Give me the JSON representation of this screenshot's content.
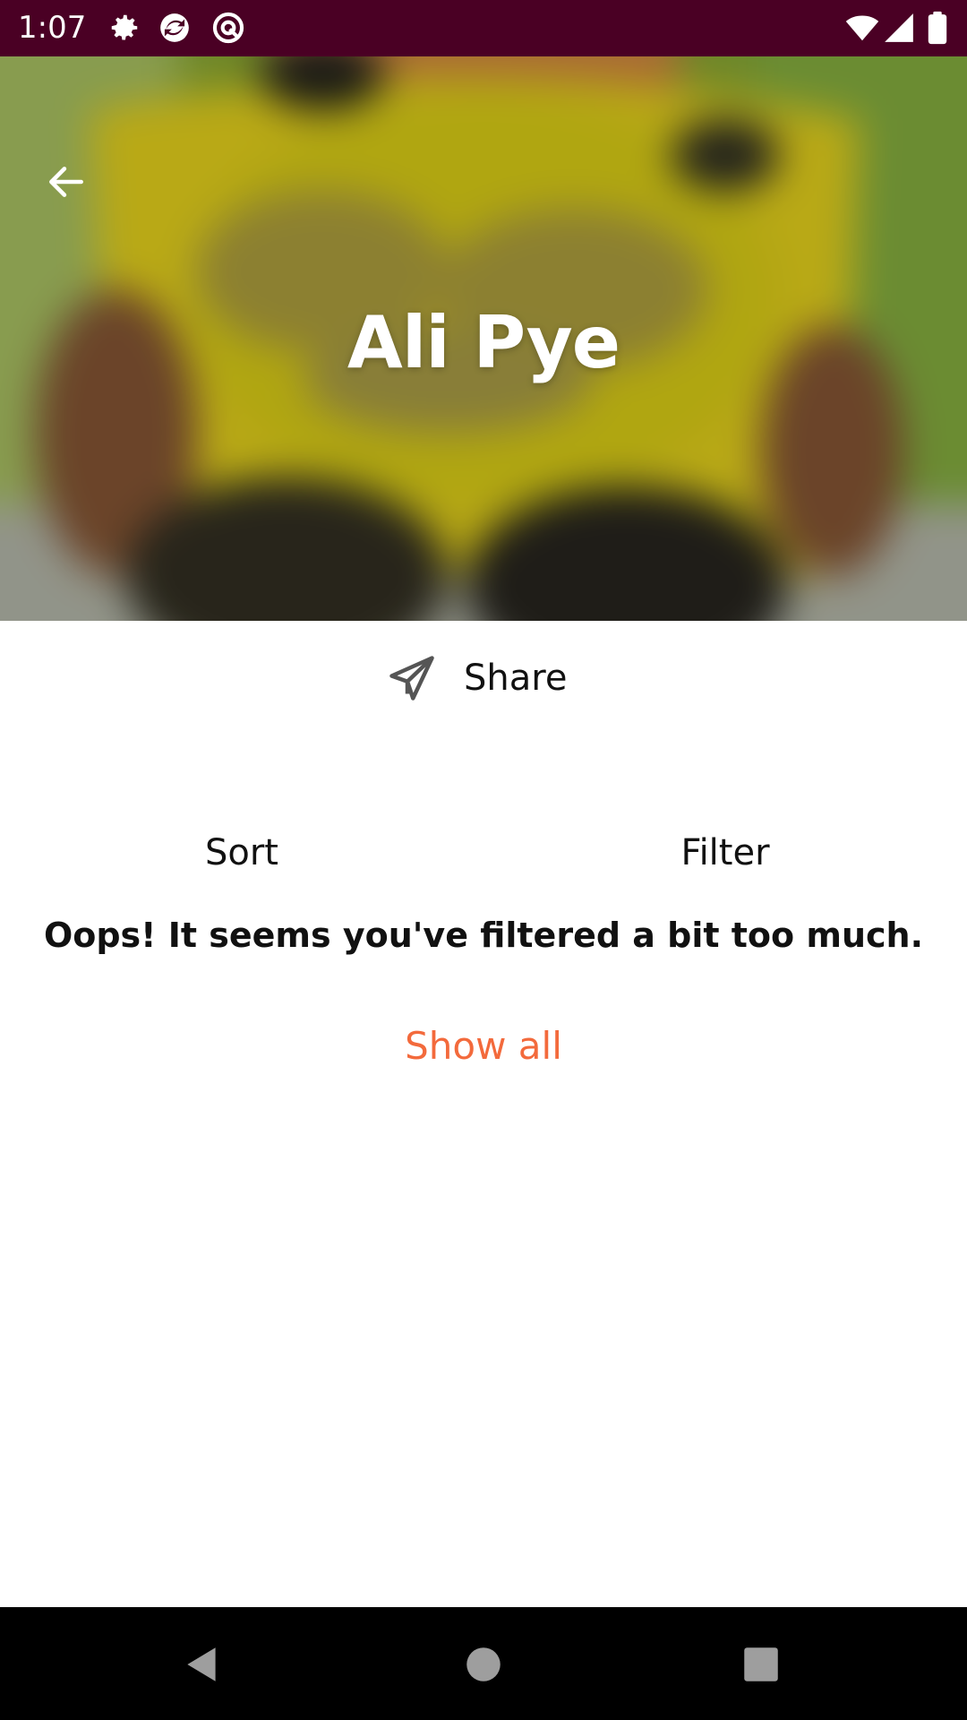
{
  "status_bar": {
    "time": "1:07",
    "icons": [
      "gear-icon",
      "sync-app-icon",
      "at-sign-app-icon",
      "wifi-icon",
      "cellular-signal-icon",
      "battery-icon"
    ],
    "background": "#4a0024"
  },
  "header": {
    "title": "Ali Pye",
    "back_icon": "arrow-left-icon"
  },
  "actions": {
    "share_label": "Share",
    "share_icon": "paper-plane-icon"
  },
  "toolbar": {
    "sort_label": "Sort",
    "filter_label": "Filter"
  },
  "empty_state": {
    "message": "Oops! It seems you've filtered a bit too much.",
    "show_all_label": "Show all",
    "accent_color": "#f36a3c"
  },
  "nav_bar": {
    "buttons": [
      "back-triangle-icon",
      "home-circle-icon",
      "recents-square-icon"
    ]
  }
}
